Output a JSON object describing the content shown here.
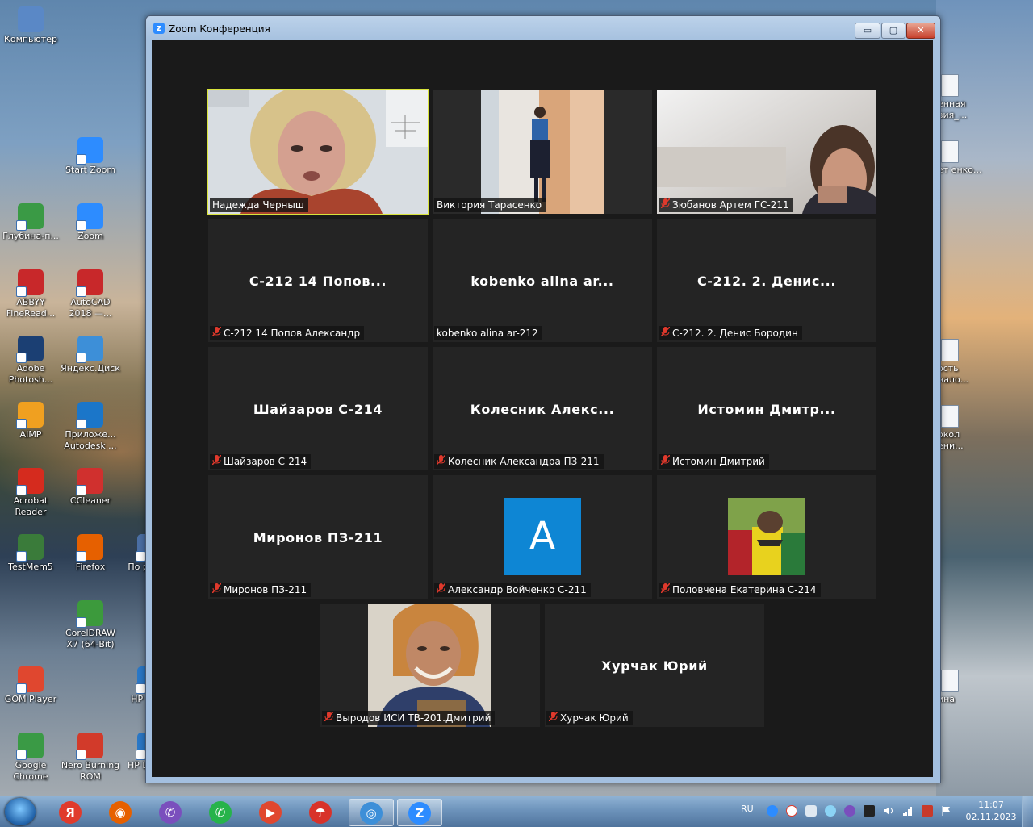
{
  "window": {
    "title": "Zoom Конференция",
    "minimize_label": "▭",
    "maximize_label": "▢",
    "close_label": "✕"
  },
  "participants": [
    {
      "center_name": "",
      "label": "Надежда Черныш",
      "muted": false,
      "has_video": true,
      "active_speaker": true
    },
    {
      "center_name": "",
      "label": "Виктория Тарасенко",
      "muted": false,
      "has_video": true,
      "active_speaker": false
    },
    {
      "center_name": "",
      "label": "Зюбанов Артем ГС-211",
      "muted": true,
      "has_video": true,
      "active_speaker": false
    },
    {
      "center_name": "С-212 14 Попов...",
      "label": "С-212 14 Попов Александр",
      "muted": true,
      "has_video": false
    },
    {
      "center_name": "kobenko alina ar...",
      "label": "kobenko alina ar-212",
      "muted": false,
      "has_video": false
    },
    {
      "center_name": "С-212. 2. Денис...",
      "label": "С-212. 2. Денис Бородин",
      "muted": true,
      "has_video": false
    },
    {
      "center_name": "Шайзаров С-214",
      "label": "Шайзаров С-214",
      "muted": true,
      "has_video": false
    },
    {
      "center_name": "Колесник Алекс...",
      "label": "Колесник Александра ПЗ-211",
      "muted": true,
      "has_video": false
    },
    {
      "center_name": "Истомин Дмитр...",
      "label": "Истомин Дмитрий",
      "muted": true,
      "has_video": false
    },
    {
      "center_name": "Миронов ПЗ-211",
      "label": "Миронов ПЗ-211",
      "muted": true,
      "has_video": false
    },
    {
      "center_name": "",
      "label": "Александр Войченко С-211",
      "muted": true,
      "has_video": false,
      "avatar_letter": "A",
      "avatar_color": "#0e86d4"
    },
    {
      "center_name": "",
      "label": "Половчена Екатерина С-214",
      "muted": true,
      "has_video": false,
      "avatar_image": true
    },
    {
      "center_name": "",
      "label": "Выродов ИСИ ТВ-201.Дмитрий",
      "muted": true,
      "has_video": true
    },
    {
      "center_name": "Хурчак Юрий",
      "label": "Хурчак Юрий",
      "muted": true,
      "has_video": false
    }
  ],
  "desktop_icons": [
    {
      "label": "Компьютер",
      "icon": "computer-icon",
      "color": "#5a88c6"
    },
    {
      "label": "Start Zoom",
      "icon": "zoom-icon",
      "color": "#2d8cff"
    },
    {
      "label": "Глубина-п...",
      "icon": "chrome-icon",
      "color": "#3a9a45"
    },
    {
      "label": "Zoom",
      "icon": "zoom-icon",
      "color": "#2d8cff"
    },
    {
      "label": "ABBYY FineRead...",
      "icon": "abbyy-icon",
      "color": "#c8282a"
    },
    {
      "label": "AutoCAD 2018 —...",
      "icon": "autocad-icon",
      "color": "#c8282a"
    },
    {
      "label": "Adobe Photosh...",
      "icon": "photoshop-icon",
      "color": "#1b3f73"
    },
    {
      "label": "Яндекс.Диск",
      "icon": "yandex-disk-icon",
      "color": "#3d8fd8"
    },
    {
      "label": "AIMP",
      "icon": "aimp-icon",
      "color": "#f0a020"
    },
    {
      "label": "Приложе... Autodesk ...",
      "icon": "autodesk-icon",
      "color": "#1b76c9"
    },
    {
      "label": "Acrobat Reader",
      "icon": "acrobat-icon",
      "color": "#d52b1e"
    },
    {
      "label": "CCleaner",
      "icon": "ccleaner-icon",
      "color": "#d0302e"
    },
    {
      "label": "TestMem5",
      "icon": "testmem-icon",
      "color": "#3a7b3a"
    },
    {
      "label": "Firefox",
      "icon": "firefox-icon",
      "color": "#e66000"
    },
    {
      "label": "По расх...",
      "icon": "app-icon",
      "color": "#4b6fa5"
    },
    {
      "label": "CorelDRAW X7 (64-Bit)",
      "icon": "coreldraw-icon",
      "color": "#3c9a3c"
    },
    {
      "label": "GOM Player",
      "icon": "gom-icon",
      "color": "#e0472f"
    },
    {
      "label": "HP Cre...",
      "icon": "hp-icon",
      "color": "#2a78c7"
    },
    {
      "label": "Google Chrome",
      "icon": "chrome-icon",
      "color": "#3a9a45"
    },
    {
      "label": "Nero Burning ROM",
      "icon": "nero-icon",
      "color": "#d23a2a"
    },
    {
      "label": "HP L 2050",
      "icon": "hp-icon",
      "color": "#2a78c7"
    }
  ],
  "right_icons": [
    {
      "label": "енная вия_...",
      "icon": "document-icon"
    },
    {
      "label": "ет енко...",
      "icon": "document-icon"
    },
    {
      "label": "ость нало...",
      "icon": "document-icon"
    },
    {
      "label": "окол ени...",
      "icon": "document-icon"
    },
    {
      "label": "ина",
      "icon": "recycle-icon"
    }
  ],
  "taskbar": {
    "apps": [
      {
        "icon": "yandex-browser-icon",
        "glyph": "Я",
        "color": "#e03b2c"
      },
      {
        "icon": "firefox-icon",
        "glyph": "◉",
        "color": "#e66000"
      },
      {
        "icon": "viber-icon",
        "glyph": "✆",
        "color": "#7a4fbd"
      },
      {
        "icon": "whatsapp-icon",
        "glyph": "✆",
        "color": "#26b34a"
      },
      {
        "icon": "gom-player-icon",
        "glyph": "▶",
        "color": "#e0472f"
      },
      {
        "icon": "umbrella-app-icon",
        "glyph": "☂",
        "color": "#d8322a"
      },
      {
        "icon": "ufo-app-icon",
        "glyph": "◎",
        "color": "#3d8fd8"
      },
      {
        "icon": "zoom-icon",
        "glyph": "Z",
        "color": "#2d8cff"
      }
    ],
    "language": "RU",
    "time": "11:07",
    "date": "02.11.2023"
  }
}
